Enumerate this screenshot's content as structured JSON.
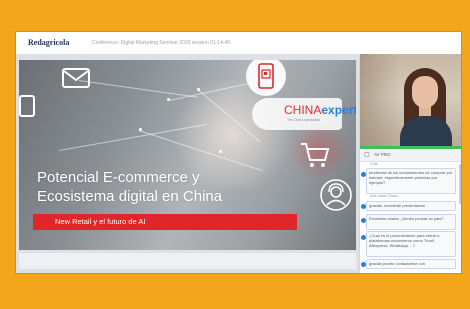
{
  "header": {
    "brand": "Redagricola",
    "webinar_title": "Conference: Digital Marketing Seminar 2020 session 01-14-45"
  },
  "slide": {
    "logo_part1": "CHINA",
    "logo_part2": "expert",
    "logo_sub": "The China specialists",
    "headline_line1": "Potencial E-commerce y",
    "headline_line2": "Ecosistema digital en China",
    "subtitle": "New Retail y el futuro de AI"
  },
  "chat": {
    "header_label": "AV PRO",
    "messages": [
      {
        "sender": "Chat",
        "text": "tendencia de los consumidores de comprar por internet, especificamente primicias por ejemplo?"
      },
      {
        "sender": "Ana Isabel Flores",
        "text": "gracias, excelente presentación"
      },
      {
        "sender": "",
        "text": "Excelente charla, ¿tienen pensar so pais?"
      },
      {
        "sender": "",
        "text": "¿Cual es el procedimiento para entrar a plataformas ecommerce como Tmall, Aliexpress, WhatsApp... ?"
      },
      {
        "sender": "",
        "text": "gracias pronto contactarme con"
      }
    ]
  },
  "icons": [
    "mail-icon",
    "phone-qr-icon",
    "cart-icon",
    "support-agent-icon",
    "chat-icon"
  ],
  "colors": {
    "frame": "#f3a51b",
    "accent_red": "#e0262a",
    "chat_border": "#c8d8ea",
    "live_green": "#3fbf5a"
  }
}
